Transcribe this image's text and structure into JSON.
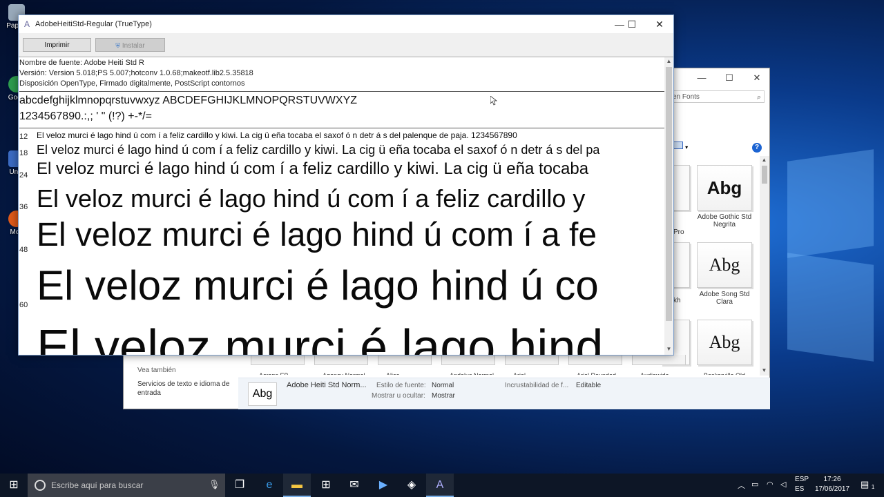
{
  "desktop": {
    "icons": [
      {
        "label": "Pap\nre"
      },
      {
        "label": "Goog"
      },
      {
        "label": "Uni\n("
      },
      {
        "label": "Moz"
      }
    ]
  },
  "explorer": {
    "search_placeholder": "en Fonts",
    "minimize": "—",
    "maximize": "☐",
    "close": "✕",
    "help": "?",
    "tiles": [
      {
        "sample": "Abg",
        "name": "Adobe Gothic Std Negrita"
      },
      {
        "sample": "Abg",
        "name": "Adobe Song Std Clara"
      },
      {
        "sample": "Abg",
        "name": ""
      }
    ],
    "partial_labels": [
      "Pro",
      "kh"
    ],
    "bottom_labels": [
      "Acrops EB",
      "Agency Normal",
      "Alice",
      "Andalus Normal",
      "Arial",
      "Arial Rounded",
      "Audiowide",
      "Baskerville Old"
    ],
    "see_also": "Vea también",
    "side_link": "Servicios de texto e idioma de entrada",
    "details": {
      "sample": "Abg",
      "font_name": "Adobe Heiti Std Norm...",
      "style_label": "Estilo de fuente:",
      "style_value": "Normal",
      "show_label": "Mostrar u ocultar:",
      "show_value": "Mostrar",
      "embed_label": "Incrustabilidad de f...",
      "embed_value": "Editable"
    }
  },
  "viewer": {
    "title": "AdobeHeitiStd-Regular (TrueType)",
    "minimize": "—",
    "maximize": "☐",
    "close": "✕",
    "print_label": "Imprimir",
    "install_label": "Instalar",
    "font_name_line": "Nombre de fuente: Adobe Heiti Std R",
    "version_line": "Versión: Version 5.018;PS 5.007;hotconv 1.0.68;makeotf.lib2.5.35818",
    "disposition_line": "Disposición OpenType, Firmado digitalmente,  PostScript  contornos",
    "charset_line1": "abcdefghijklmnopqrstuvwxyz ABCDEFGHIJKLMNOPQRSTUVWXYZ",
    "charset_line2": "1234567890.:,; ' \" (!?) +-*/=",
    "samples": [
      {
        "size": "12",
        "text": "El veloz murci é lago hind ú  com  í  a feliz cardillo y kiwi. La cig ü eña tocaba el saxof ó n detr á s del palenque de paja. 1234567890"
      },
      {
        "size": "18",
        "text": "El veloz murci é lago hind ú  com  í  a feliz cardillo y kiwi. La cig ü eña tocaba el saxof ó n detr á s del pa"
      },
      {
        "size": "24",
        "text": "El veloz murci é lago hind ú  com  í  a feliz cardillo y kiwi. La cig ü eña tocaba"
      },
      {
        "size": "36",
        "text": "El veloz murci é lago hind ú  com  í  a feliz cardillo y"
      },
      {
        "size": "48",
        "text": "El veloz murci é lago hind ú  com  í  a fe"
      },
      {
        "size": "60",
        "text": "El veloz murci é lago hind ú  co"
      },
      {
        "size": "",
        "text": "El veloz murci é lago hind"
      }
    ]
  },
  "taskbar": {
    "start": "⊞",
    "search_placeholder": "Escribe aquí para buscar",
    "lang_top": "ESP",
    "lang_bottom": "ES",
    "time": "17:26",
    "date": "17/06/2017",
    "notification_count": "1"
  }
}
